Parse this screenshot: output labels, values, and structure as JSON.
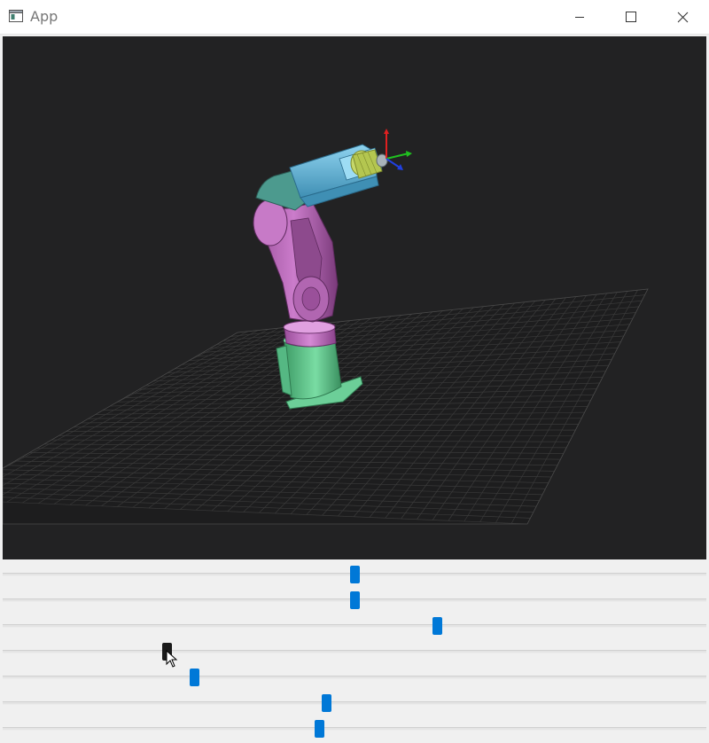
{
  "window": {
    "title": "App",
    "icon": "app-window-icon",
    "controls": [
      "minimize-icon",
      "maximize-icon",
      "close-icon"
    ]
  },
  "viewport": {
    "scene": "3d-robot-arm",
    "background_color": "#222223",
    "floor_grid": true,
    "gizmo_axes": [
      "x",
      "y",
      "z"
    ],
    "axis_colors": {
      "x": "#e02020",
      "y": "#20c020",
      "z": "#2040e0"
    },
    "link_colors": {
      "base": "#5fc98c",
      "shoulder": "#c77ac7",
      "upper_arm": "#b865b8",
      "forearm": "#62b3d6",
      "wrist": "#c6d86a"
    }
  },
  "sliders": [
    {
      "name": "joint-1",
      "value": 0.5,
      "state": "normal"
    },
    {
      "name": "joint-2",
      "value": 0.5,
      "state": "normal"
    },
    {
      "name": "joint-3",
      "value": 0.62,
      "state": "normal"
    },
    {
      "name": "joint-4",
      "value": 0.23,
      "state": "pressed"
    },
    {
      "name": "joint-5",
      "value": 0.27,
      "state": "normal"
    },
    {
      "name": "joint-6",
      "value": 0.46,
      "state": "normal"
    },
    {
      "name": "joint-7",
      "value": 0.45,
      "state": "normal"
    }
  ],
  "colors": {
    "handle_normal": "#0078d7",
    "handle_pressed": "#1a1a1a",
    "track": "#e4e4e4"
  }
}
